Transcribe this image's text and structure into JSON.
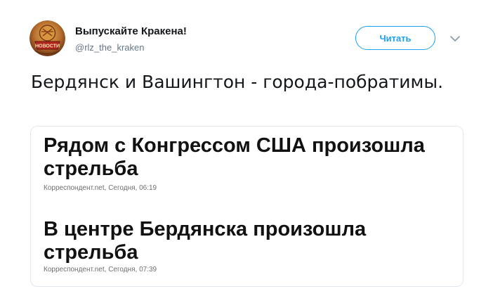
{
  "author": {
    "name": "Выпускайте Кракена!",
    "handle": "@rlz_the_kraken",
    "avatar_icon": "soviet-news-badge-icon",
    "avatar_text": "НОВОСТИ"
  },
  "follow_button": {
    "label": "Читать"
  },
  "more_icon": "chevron-down-icon",
  "tweet": {
    "text": "Бердянск и Вашингтон - города-побратимы."
  },
  "news": [
    {
      "headline": "Рядом с Конгрессом США произошла стрельба",
      "meta": "Корреспондент.net, Сегодня, 06:19"
    },
    {
      "headline": "В центре Бердянска произошла стрельба",
      "meta": "Корреспондент.net, Сегодня, 07:39"
    }
  ],
  "colors": {
    "accent": "#1da1f2",
    "handle": "#657786",
    "text": "#14171a",
    "border": "#e1e8ed"
  }
}
